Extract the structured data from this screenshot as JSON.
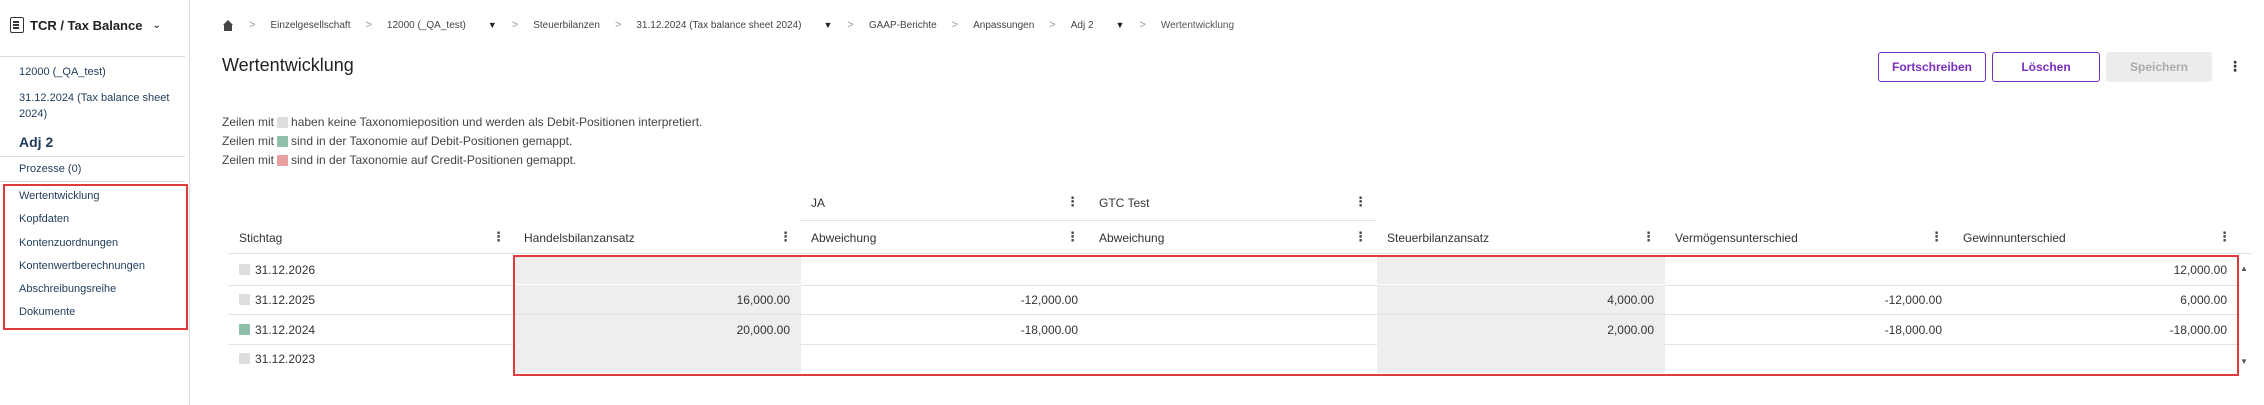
{
  "sidebar": {
    "app_title": "TCR / Tax Balance",
    "context_company": "12000 (_QA_test)",
    "context_period": "31.12.2024 (Tax balance sheet 2024)",
    "context_adjustment": "Adj 2",
    "processes": "Prozesse (0)",
    "items": [
      {
        "label": "Wertentwicklung"
      },
      {
        "label": "Kopfdaten"
      },
      {
        "label": "Kontenzuordnungen"
      },
      {
        "label": "Kontenwertberechnungen"
      },
      {
        "label": "Abschreibungsreihe"
      },
      {
        "label": "Dokumente"
      }
    ]
  },
  "breadcrumb": {
    "items": [
      {
        "label": "Einzelgesellschaft"
      },
      {
        "label": "12000 (_QA_test)"
      },
      {
        "label": "Steuerbilanzen"
      },
      {
        "label": "31.12.2024 (Tax balance sheet 2024)"
      },
      {
        "label": "GAAP-Berichte"
      },
      {
        "label": "Anpassungen"
      },
      {
        "label": "Adj 2"
      },
      {
        "label": "Wertentwicklung"
      }
    ]
  },
  "page": {
    "title": "Wertentwicklung",
    "btn_update": "Fortschreiben",
    "btn_delete": "Löschen",
    "btn_save": "Speichern"
  },
  "legend": {
    "line1_prefix": "Zeilen mit",
    "line1_suffix": "haben keine Taxonomieposition und werden als Debit-Positionen interpretiert.",
    "line2_prefix": "Zeilen mit",
    "line2_suffix": "sind in der Taxonomie auf Debit-Positionen gemappt.",
    "line3_prefix": "Zeilen mit",
    "line3_suffix": "sind in der Taxonomie auf Credit-Positionen gemappt."
  },
  "colors": {
    "accent": "#7b2fbf",
    "highlight": "#e03b3b",
    "no_taxonomy": "#dddddd",
    "debit": "#8fbfa8",
    "credit": "#e8a0a0"
  },
  "table": {
    "group_ja": "JA",
    "group_gtc": "GTC Test",
    "columns": {
      "stichtag": "Stichtag",
      "handelsbilanzansatz": "Handelsbilanzansatz",
      "abweichung_ja": "Abweichung",
      "abweichung_gtc": "Abweichung",
      "steuerbilanzansatz": "Steuerbilanzansatz",
      "vermoegensunterschied": "Vermögensunterschied",
      "gewinnunterschied": "Gewinnunterschied"
    },
    "rows": [
      {
        "date": "31.12.2026",
        "swatch": "no_taxonomy",
        "handelsbilanzansatz": "",
        "abweichung_ja": "",
        "abweichung_gtc": "",
        "steuerbilanzansatz": "",
        "vermoegensunterschied": "",
        "gewinnunterschied": "12,000.00"
      },
      {
        "date": "31.12.2025",
        "swatch": "no_taxonomy",
        "handelsbilanzansatz": "16,000.00",
        "abweichung_ja": "-12,000.00",
        "abweichung_gtc": "",
        "steuerbilanzansatz": "4,000.00",
        "vermoegensunterschied": "-12,000.00",
        "gewinnunterschied": "6,000.00"
      },
      {
        "date": "31.12.2024",
        "swatch": "debit",
        "handelsbilanzansatz": "20,000.00",
        "abweichung_ja": "-18,000.00",
        "abweichung_gtc": "",
        "steuerbilanzansatz": "2,000.00",
        "vermoegensunterschied": "-18,000.00",
        "gewinnunterschied": "-18,000.00"
      },
      {
        "date": "31.12.2023",
        "swatch": "no_taxonomy",
        "handelsbilanzansatz": "",
        "abweichung_ja": "",
        "abweichung_gtc": "",
        "steuerbilanzansatz": "",
        "vermoegensunterschied": "",
        "gewinnunterschied": ""
      }
    ]
  }
}
